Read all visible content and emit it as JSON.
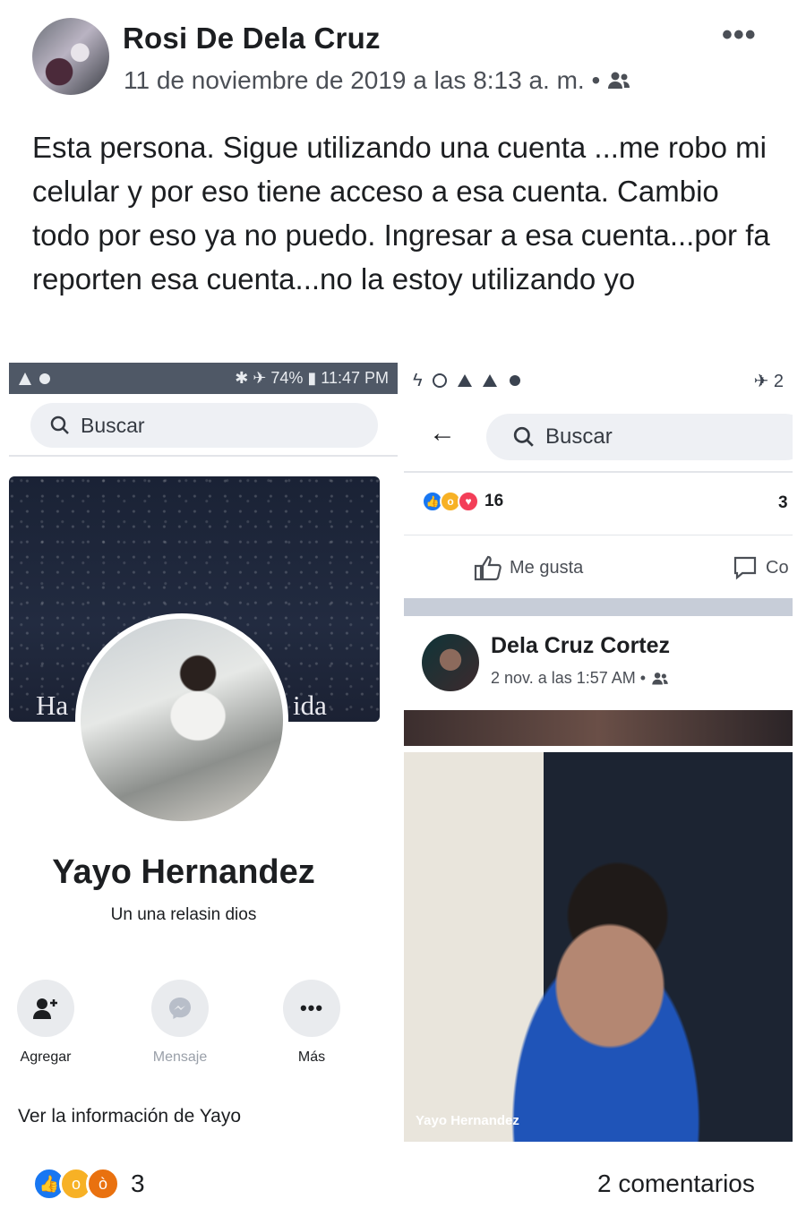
{
  "post": {
    "author": "Rosi De Dela Cruz",
    "timestamp": "11 de noviembre de 2019 a las 8:13 a. m. •",
    "more_label": "•••",
    "text": "Esta persona. Sigue utilizando una cuenta ...me robo mi celular y por eso tiene acceso a esa cuenta. Cambio todo por eso ya no puedo. Ingresar a esa cuenta...por fa reporten esa cuenta...no la estoy utilizando yo",
    "reactions_count": "3",
    "comments": "2 comentarios"
  },
  "left_screenshot": {
    "status_right": "✱ ✈ 74% ▮ 11:47 PM",
    "search_placeholder": "Buscar",
    "cover_left_text": "Ha",
    "cover_right_text": "ida",
    "profile_name": "Yayo Hernandez",
    "bio": "Un una relasin dios",
    "actions": [
      {
        "label": "Agregar"
      },
      {
        "label": "Mensaje"
      },
      {
        "label": "Más"
      }
    ],
    "info_link": "Ver la información de Yayo"
  },
  "right_screenshot": {
    "status_right": "✈ 2",
    "search_placeholder": "Buscar",
    "reactions_count": "16",
    "comments_count": "3",
    "like_label": "Me gusta",
    "comment_label": "Co",
    "post_author": "Dela Cruz Cortez",
    "post_time": "2 nov. a las 1:57 AM •",
    "watermark": "Yayo Hernandez"
  },
  "colors": {
    "like_blue": "#1877f2",
    "wow_yellow": "#f7b125",
    "angry_orange": "#e9710f",
    "love_red": "#f33e58"
  }
}
